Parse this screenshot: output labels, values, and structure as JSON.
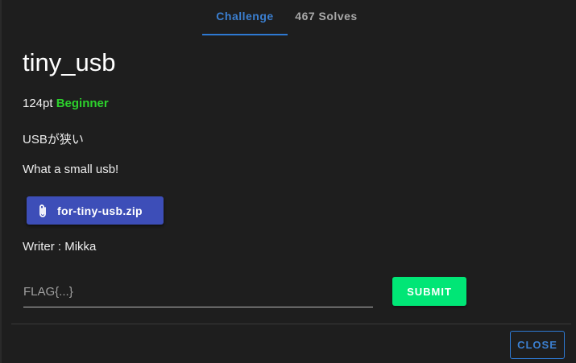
{
  "tabs": [
    {
      "label": "Challenge",
      "active": true
    },
    {
      "label": "467 Solves",
      "active": false
    }
  ],
  "challenge": {
    "title": "tiny_usb",
    "points": "124pt",
    "category": "Beginner",
    "category_color": "#2cd12c",
    "description_jp": "USBが狭い",
    "description_en": "What a small usb!",
    "file": {
      "name": "for-tiny-usb.zip",
      "icon": "paperclip-icon"
    },
    "writer": "Writer : Mikka"
  },
  "flag_form": {
    "placeholder": "FLAG{...}",
    "value": "",
    "submit_label": "SUBMIT"
  },
  "footer": {
    "close_label": "CLOSE"
  },
  "colors": {
    "background": "#1e1e1e",
    "accent_blue": "#2e79d2",
    "file_button": "#3d4eb8",
    "submit_green": "#00e676"
  }
}
